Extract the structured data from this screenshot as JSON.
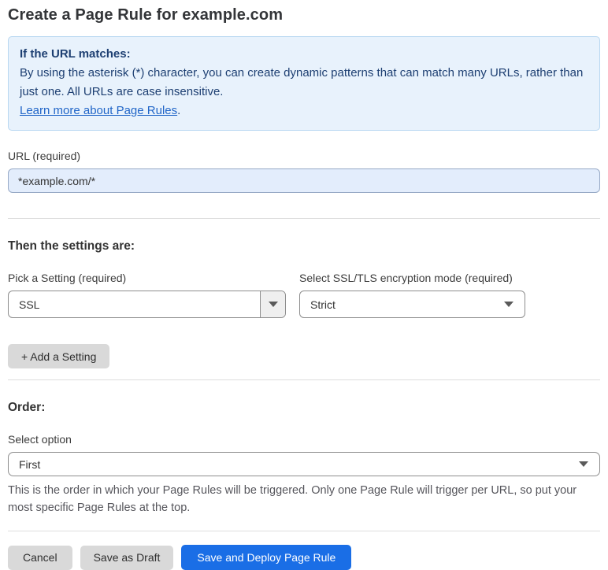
{
  "page": {
    "title": "Create a Page Rule for example.com"
  },
  "info_box": {
    "heading": "If the URL matches:",
    "body": "By using the asterisk (*) character, you can create dynamic patterns that can match many URLs, rather than just one. All URLs are case insensitive.",
    "link_label": "Learn more about Page Rules",
    "link_suffix": "."
  },
  "url_field": {
    "label": "URL (required)",
    "value": "*example.com/*"
  },
  "settings_section": {
    "heading": "Then the settings are:",
    "setting_picker": {
      "label": "Pick a Setting (required)",
      "value": "SSL"
    },
    "mode_picker": {
      "label": "Select SSL/TLS encryption mode (required)",
      "value": "Strict"
    },
    "add_setting_label": "+ Add a Setting"
  },
  "order_section": {
    "heading": "Order:",
    "label": "Select option",
    "value": "First",
    "help_text": "This is the order in which your Page Rules will be triggered. Only one Page Rule will trigger per URL, so put your most specific Page Rules at the top."
  },
  "actions": {
    "cancel_label": "Cancel",
    "save_draft_label": "Save as Draft",
    "save_deploy_label": "Save and Deploy Page Rule"
  },
  "colors": {
    "info_bg": "#e8f2fc",
    "info_border": "#b8d7f1",
    "info_text": "#1d3f72",
    "link_blue": "#2166c8",
    "url_input_bg": "#e3edfc",
    "secondary_button_bg": "#d9d9d9",
    "primary_button_bg": "#1a6ee6"
  }
}
